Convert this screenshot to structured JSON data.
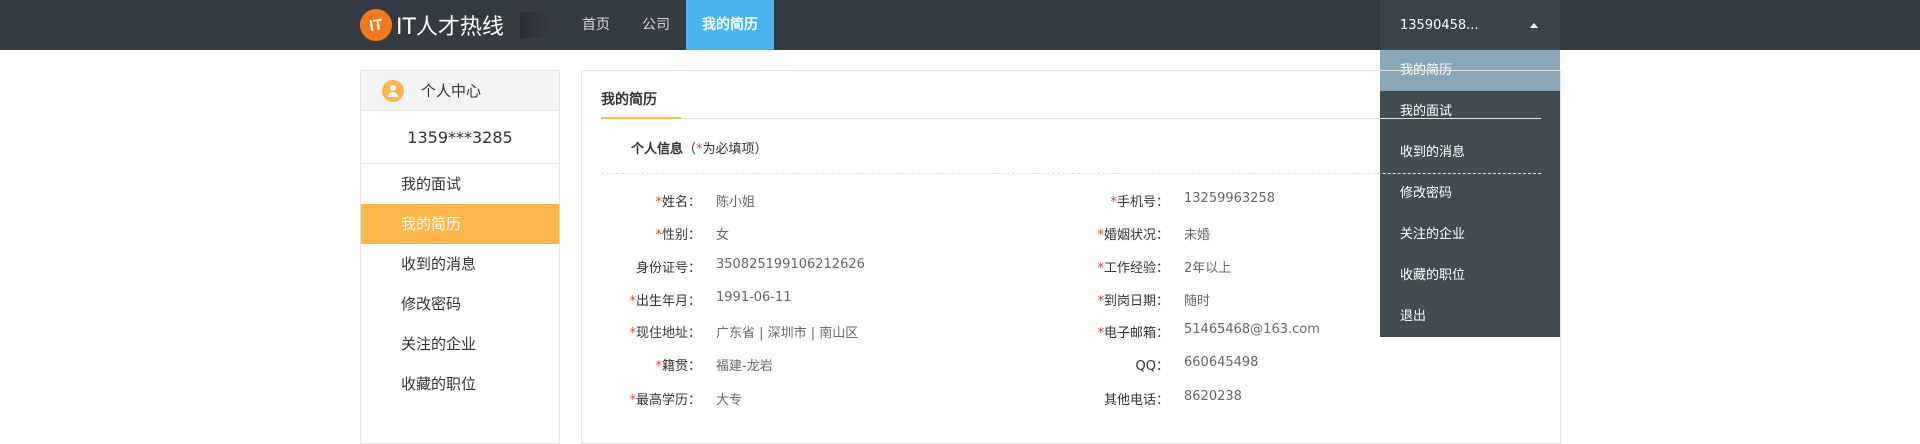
{
  "header": {
    "logo_badge": "IT",
    "logo_text": "IT人才热线",
    "nav": [
      {
        "label": "首页"
      },
      {
        "label": "公司"
      },
      {
        "label": "我的简历"
      }
    ],
    "user": "13590458...",
    "dropdown": [
      {
        "label": "我的简历"
      },
      {
        "label": "我的面试"
      },
      {
        "label": "收到的消息"
      },
      {
        "label": "修改密码"
      },
      {
        "label": "关注的企业"
      },
      {
        "label": "收藏的职位"
      },
      {
        "label": "退出"
      }
    ]
  },
  "sidebar": {
    "title": "个人中心",
    "phone": "1359***3285",
    "items": [
      {
        "label": "我的面试"
      },
      {
        "label": "我的简历"
      },
      {
        "label": "收到的消息"
      },
      {
        "label": "修改密码"
      },
      {
        "label": "关注的企业"
      },
      {
        "label": "收藏的职位"
      }
    ]
  },
  "main": {
    "tab": "我的简历",
    "section_title": "个人信息",
    "section_note_open": "（",
    "section_note_star": "*",
    "section_note": "为必填项）",
    "left_fields": [
      {
        "star": "*",
        "label": "姓名：",
        "value": "陈小姐"
      },
      {
        "star": "*",
        "label": "性别：",
        "value": "女"
      },
      {
        "star": "",
        "label": "身份证号：",
        "value": "350825199106212626"
      },
      {
        "star": "*",
        "label": "出生年月：",
        "value": "1991-06-11"
      },
      {
        "star": "*",
        "label": "现住地址：",
        "value": "广东省 | 深圳市 | 南山区"
      },
      {
        "star": "*",
        "label": "籍贯：",
        "value": "福建-龙岩"
      },
      {
        "star": "*",
        "label": "最高学历：",
        "value": "大专"
      }
    ],
    "right_fields": [
      {
        "star": "*",
        "label": "手机号：",
        "value": "13259963258"
      },
      {
        "star": "*",
        "label": "婚姻状况：",
        "value": "未婚"
      },
      {
        "star": "*",
        "label": "工作经验：",
        "value": "2年以上"
      },
      {
        "star": "*",
        "label": "到岗日期：",
        "value": "随时"
      },
      {
        "star": "*",
        "label": "电子邮箱：",
        "value": "51465468@163.com"
      },
      {
        "star": "",
        "label": "QQ：",
        "value": "660645498"
      },
      {
        "star": "",
        "label": "其他电话：",
        "value": "8620238"
      }
    ]
  },
  "colors": {
    "topbar": "#353b42",
    "nav_active": "#49b4ee",
    "accent_orange": "#fdb64a",
    "dropdown_bg": "#414c53",
    "dropdown_active": "#8aa7b9",
    "required": "#e43b3b"
  }
}
